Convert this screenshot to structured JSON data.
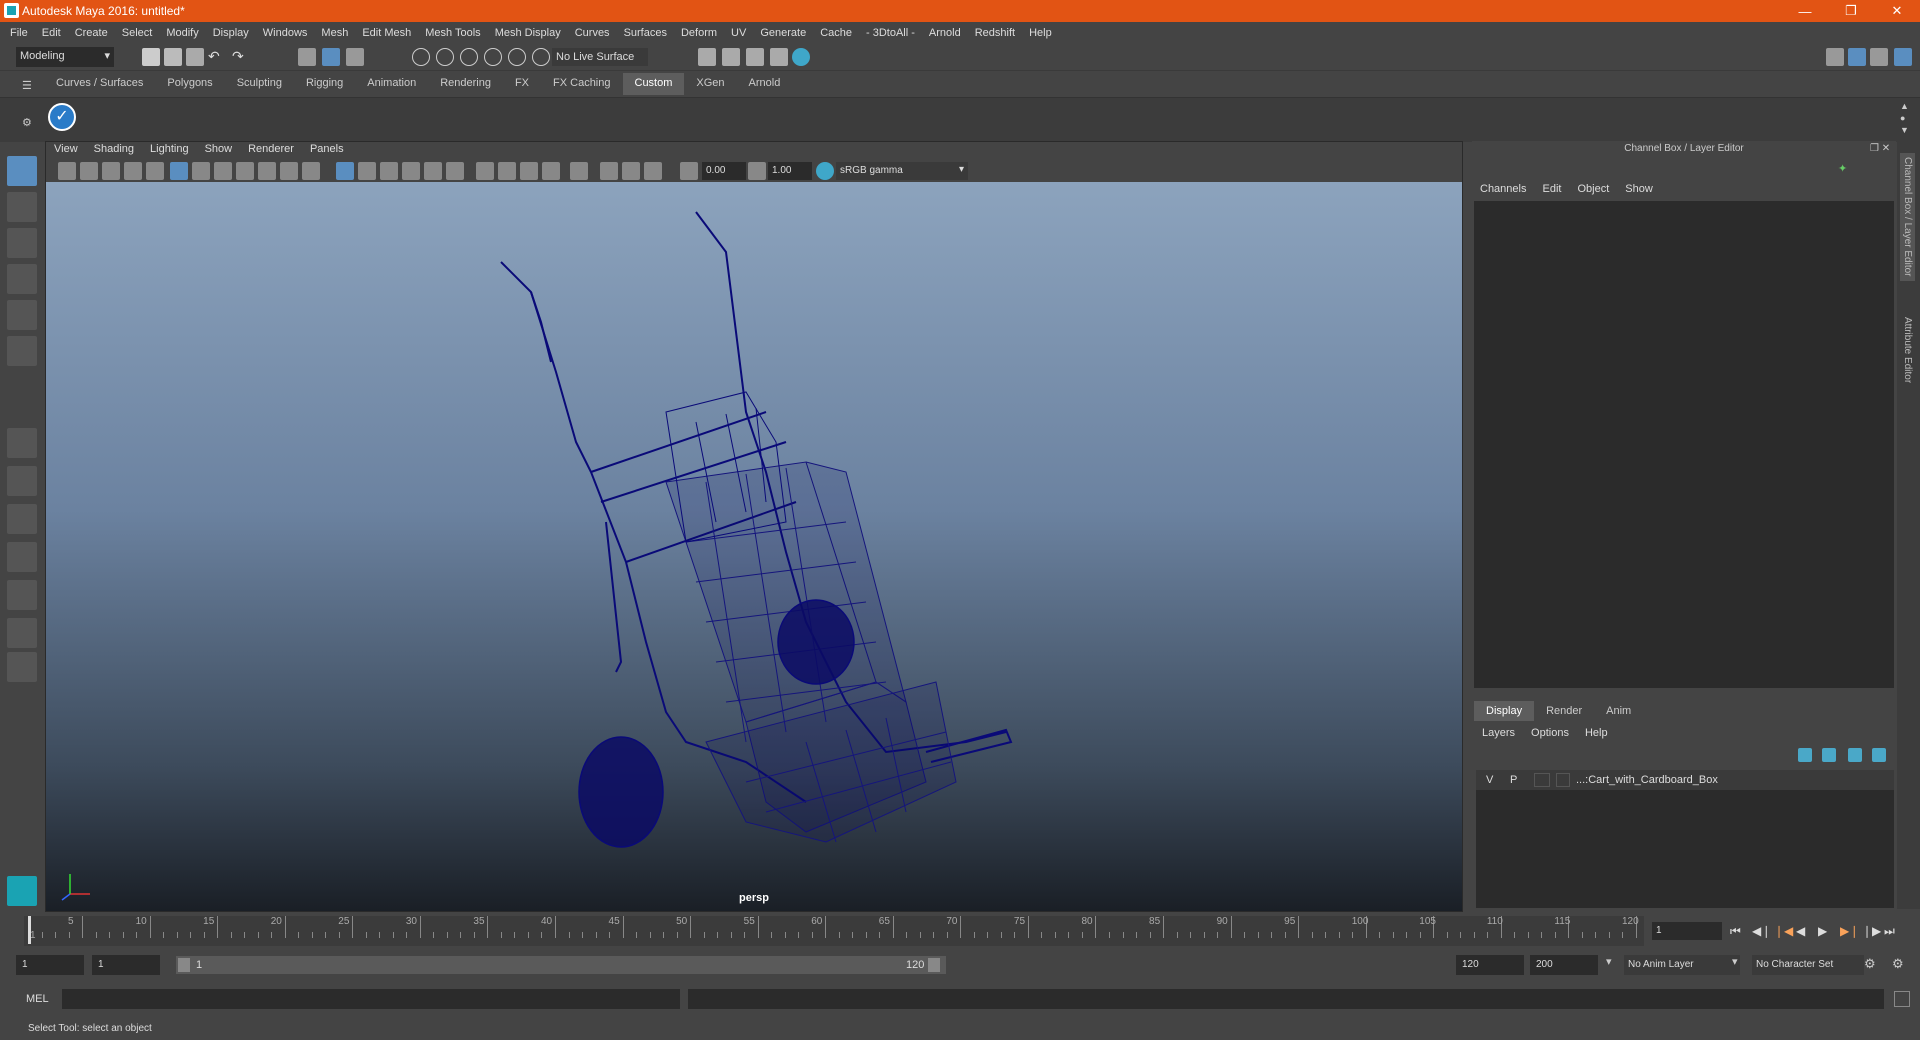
{
  "window": {
    "title": "Autodesk Maya 2016: untitled*"
  },
  "menubar": [
    "File",
    "Edit",
    "Create",
    "Select",
    "Modify",
    "Display",
    "Windows",
    "Mesh",
    "Edit Mesh",
    "Mesh Tools",
    "Mesh Display",
    "Curves",
    "Surfaces",
    "Deform",
    "UV",
    "Generate",
    "Cache",
    "- 3DtoAll -",
    "Arnold",
    "Redshift",
    "Help"
  ],
  "status": {
    "mode": "Modeling",
    "live_surface": "No Live Surface"
  },
  "shelf_tabs": [
    "Curves / Surfaces",
    "Polygons",
    "Sculpting",
    "Rigging",
    "Animation",
    "Rendering",
    "FX",
    "FX Caching",
    "Custom",
    "XGen",
    "Arnold"
  ],
  "shelf_active": "Custom",
  "panel_menu": [
    "View",
    "Shading",
    "Lighting",
    "Show",
    "Renderer",
    "Panels"
  ],
  "panel_tools": {
    "exposure": "0.00",
    "gamma": "1.00",
    "color_space": "sRGB gamma"
  },
  "viewport": {
    "camera": "persp"
  },
  "channel_box": {
    "title": "Channel Box / Layer Editor",
    "menu": [
      "Channels",
      "Edit",
      "Object",
      "Show"
    ]
  },
  "layer_editor": {
    "tabs": [
      "Display",
      "Render",
      "Anim"
    ],
    "active_tab": "Display",
    "menu": [
      "Layers",
      "Options",
      "Help"
    ],
    "layers": [
      {
        "v": "V",
        "p": "P",
        "name": "...:Cart_with_Cardboard_Box"
      }
    ]
  },
  "side_tabs": [
    "Channel Box / Layer Editor",
    "Attribute Editor"
  ],
  "timeline": {
    "ticks": [
      "1",
      "5",
      "10",
      "15",
      "20",
      "25",
      "30",
      "35",
      "40",
      "45",
      "50",
      "55",
      "60",
      "65",
      "70",
      "75",
      "80",
      "85",
      "90",
      "95",
      "100",
      "105",
      "110",
      "115",
      "120"
    ],
    "current_frame": "1"
  },
  "range": {
    "start": "1",
    "anim_start": "1",
    "slider_start": "1",
    "slider_end": "120",
    "end": "120",
    "anim_end": "200",
    "anim_layer": "No Anim Layer",
    "char_set": "No Character Set"
  },
  "cmdline": {
    "label": "MEL"
  },
  "helpline": {
    "text": "Select Tool: select an object"
  }
}
